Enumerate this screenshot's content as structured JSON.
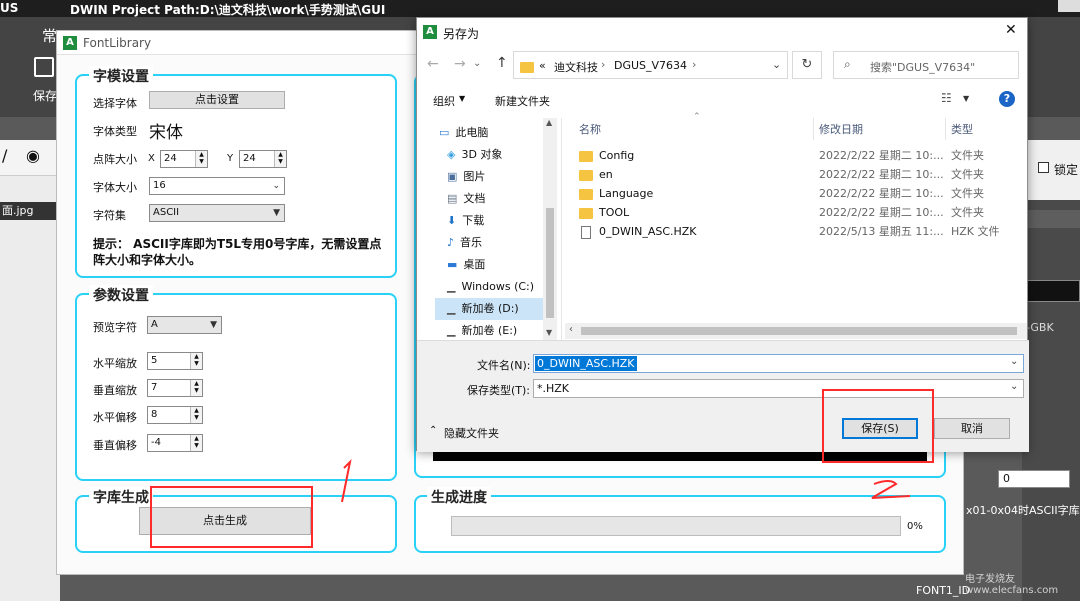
{
  "background": {
    "title": "DWIN Project Path:D:\\迪文科技\\work\\手势测试\\GUI",
    "title_prefix": "US",
    "ribbon_tab": "常",
    "save_label": "保存",
    "left_file_label": "面.jpg",
    "right_lock_label": "锁定",
    "right_gbk": "-GBK",
    "right_value_zero": "0",
    "right_ascii_note": "x01-0x04时ASCII字库位",
    "font1_id": "FONT1_ID",
    "watermark": "电子发烧友 www.elecfans.com"
  },
  "font_library": {
    "title": "FontLibrary",
    "font_settings": {
      "title": "字模设置",
      "select_font_label": "选择字体",
      "select_font_button": "点击设置",
      "font_type_label": "字体类型",
      "font_type_value": "宋体",
      "dot_size_label": "点阵大小",
      "x_label": "X",
      "x_value": "24",
      "y_label": "Y",
      "y_value": "24",
      "font_size_label": "字体大小",
      "font_size_value": "16",
      "charset_label": "字符集",
      "charset_value": "ASCII",
      "hint": "提示： ASCII字库即为T5L专用0号字库，无需设置点阵大小和字体大小。"
    },
    "param_settings": {
      "title": "参数设置",
      "preview_label": "预览字符",
      "preview_value": "A",
      "h_scale_label": "水平缩放",
      "h_scale_value": "5",
      "v_scale_label": "垂直缩放",
      "v_scale_value": "7",
      "h_offset_label": "水平偏移",
      "h_offset_value": "8",
      "v_offset_label": "垂直偏移",
      "v_offset_value": "-4"
    },
    "generate": {
      "title": "字库生成",
      "button": "点击生成"
    },
    "progress": {
      "title": "生成进度",
      "percent_text": "0%",
      "value": 0
    }
  },
  "save_dialog": {
    "title": "另存为",
    "close": "✕",
    "breadcrumb": [
      "«",
      "迪文科技",
      "DGUS_V7634"
    ],
    "search_placeholder": "搜索\"DGUS_V7634\"",
    "toolbar": {
      "organize": "组织",
      "new_folder": "新建文件夹"
    },
    "nav_items": [
      {
        "label": "此电脑",
        "icon": "computer-icon"
      },
      {
        "label": "3D 对象",
        "icon": "cube-icon"
      },
      {
        "label": "图片",
        "icon": "picture-icon"
      },
      {
        "label": "文档",
        "icon": "document-icon"
      },
      {
        "label": "下载",
        "icon": "download-icon"
      },
      {
        "label": "音乐",
        "icon": "music-icon"
      },
      {
        "label": "桌面",
        "icon": "desktop-icon"
      },
      {
        "label": "Windows (C:)",
        "icon": "drive-icon"
      },
      {
        "label": "新加卷 (D:)",
        "icon": "drive-icon"
      },
      {
        "label": "新加卷 (E:)",
        "icon": "drive-icon"
      }
    ],
    "columns": {
      "name": "名称",
      "date": "修改日期",
      "type": "类型"
    },
    "files": [
      {
        "name": "Config",
        "date": "2022/2/22 星期二 10:...",
        "type": "文件夹",
        "kind": "folder"
      },
      {
        "name": "en",
        "date": "2022/2/22 星期二 10:...",
        "type": "文件夹",
        "kind": "folder"
      },
      {
        "name": "Language",
        "date": "2022/2/22 星期二 10:...",
        "type": "文件夹",
        "kind": "folder"
      },
      {
        "name": "TOOL",
        "date": "2022/2/22 星期二 10:...",
        "type": "文件夹",
        "kind": "folder"
      },
      {
        "name": "0_DWIN_ASC.HZK",
        "date": "2022/5/13 星期五 11:...",
        "type": "HZK 文件",
        "kind": "file"
      }
    ],
    "filename_label": "文件名(N):",
    "filename_value": "0_DWIN_ASC.HZK",
    "filetype_label": "保存类型(T):",
    "filetype_value": "*.HZK",
    "hide_folders": "隐藏文件夹",
    "save_button": "保存(S)",
    "cancel_button": "取消"
  },
  "annotations": {
    "one": "1",
    "two": "2"
  }
}
